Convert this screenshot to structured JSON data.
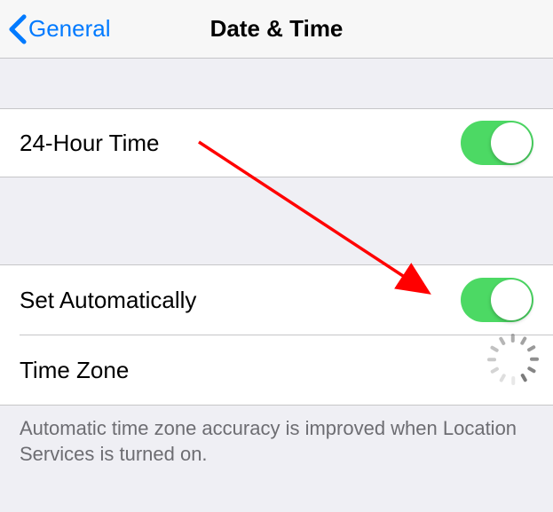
{
  "nav": {
    "back_label": "General",
    "title": "Date & Time"
  },
  "rows": {
    "twenty_four": {
      "label": "24-Hour Time",
      "on": true
    },
    "set_auto": {
      "label": "Set Automatically",
      "on": true
    },
    "time_zone": {
      "label": "Time Zone"
    }
  },
  "footer": "Automatic time zone accuracy is improved when Location Services is turned on.",
  "annotation": {
    "arrow_color": "#ff0000"
  }
}
